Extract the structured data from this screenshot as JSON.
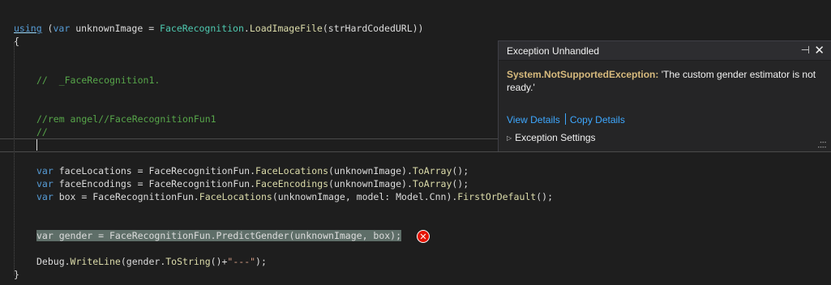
{
  "code": {
    "l1_kw": "using",
    "l1_open": " (",
    "l1_var": "var",
    "l1_rest": " unknownImage = ",
    "l1_type": "FaceRecognition",
    "l1_dot": ".",
    "l1_fn": "LoadImageFile",
    "l1_args": "(strHardCodedURL))",
    "l2": "{",
    "l3_comment": "//  _FaceRecognition1.",
    "l4_comment": "//rem angel//FaceRecognitionFun1",
    "l5_comment": "//",
    "l6_var": "var",
    "l6_mid": " faceLocations = FaceRecognitionFun.",
    "l6_fn": "FaceLocations",
    "l6_args": "(unknownImage).",
    "l6_fn2": "ToArray",
    "l6_end": "();",
    "l7_var": "var",
    "l7_mid": " faceEncodings = FaceRecognitionFun.",
    "l7_fn": "FaceEncodings",
    "l7_args": "(unknownImage).",
    "l7_fn2": "ToArray",
    "l7_end": "();",
    "l8_var": "var",
    "l8_mid": " box = FaceRecognitionFun.",
    "l8_fn": "FaceLocations",
    "l8_args": "(unknownImage, model: Model.Cnn).",
    "l8_fn2": "FirstOrDefault",
    "l8_end": "();",
    "l9_text": "var gender = FaceRecognitionFun.PredictGender(unknownImage, box);",
    "l10_a": "Debug.",
    "l10_fn": "WriteLine",
    "l10_b": "(gender.",
    "l10_fn2": "ToString",
    "l10_c": "()+",
    "l10_str": "\"---\"",
    "l10_d": ");",
    "l11": "}"
  },
  "exception_popup": {
    "title": "Exception Unhandled",
    "exception_type": "System.NotSupportedException:",
    "message": "'The custom gender estimator is not ready.'",
    "view_details": "View Details",
    "copy_details": "Copy Details",
    "settings_label": "Exception Settings",
    "pin_icon": "pin-icon",
    "close_icon": "close-icon"
  },
  "error_glyph": "error-icon",
  "colors": {
    "background": "#1e1e1e",
    "keyword": "#569cd6",
    "type": "#4ec9b0",
    "method": "#dcdcaa",
    "comment": "#57a64a",
    "link": "#3ea8ff",
    "exception_type": "#d7ba7d",
    "error": "#e51400"
  }
}
